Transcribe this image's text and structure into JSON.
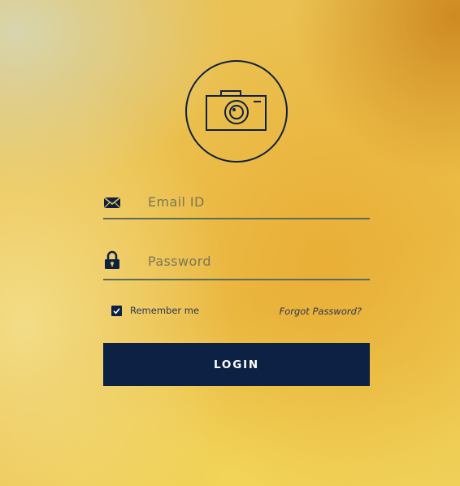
{
  "logo": {
    "icon": "camera-icon"
  },
  "email": {
    "icon": "envelope-icon",
    "placeholder": "Email ID",
    "value": ""
  },
  "password": {
    "icon": "lock-icon",
    "placeholder": "Password",
    "value": ""
  },
  "remember": {
    "label": "Remember me",
    "checked": true
  },
  "forgot": {
    "label": "Forgot Password?"
  },
  "login": {
    "label": "LOGIN"
  },
  "colors": {
    "primary": "#0d2144",
    "underline": "#5e6a5c",
    "background": "#ecc04c"
  }
}
